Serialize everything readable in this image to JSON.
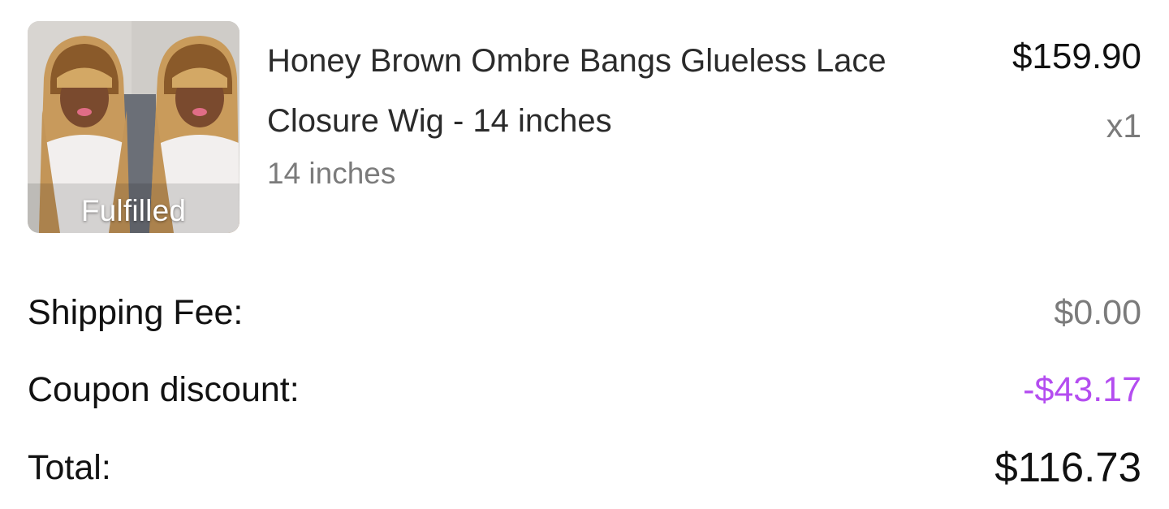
{
  "product": {
    "title_line1": "Honey Brown Ombre Bangs Glueless Lace",
    "title_line2": "Closure Wig - 14 inches",
    "variant": "14 inches",
    "price": "$159.90",
    "quantity": "x1",
    "status": "Fulfilled",
    "image_icon": "product-photo"
  },
  "summary": {
    "shipping_label": "Shipping Fee:",
    "shipping_value": "$0.00",
    "coupon_label": "Coupon discount:",
    "coupon_value": "-$43.17",
    "total_label": "Total:",
    "total_value": "$116.73"
  },
  "colors": {
    "coupon": "#b44df0",
    "muted": "#7b7b7b",
    "text": "#111111"
  }
}
